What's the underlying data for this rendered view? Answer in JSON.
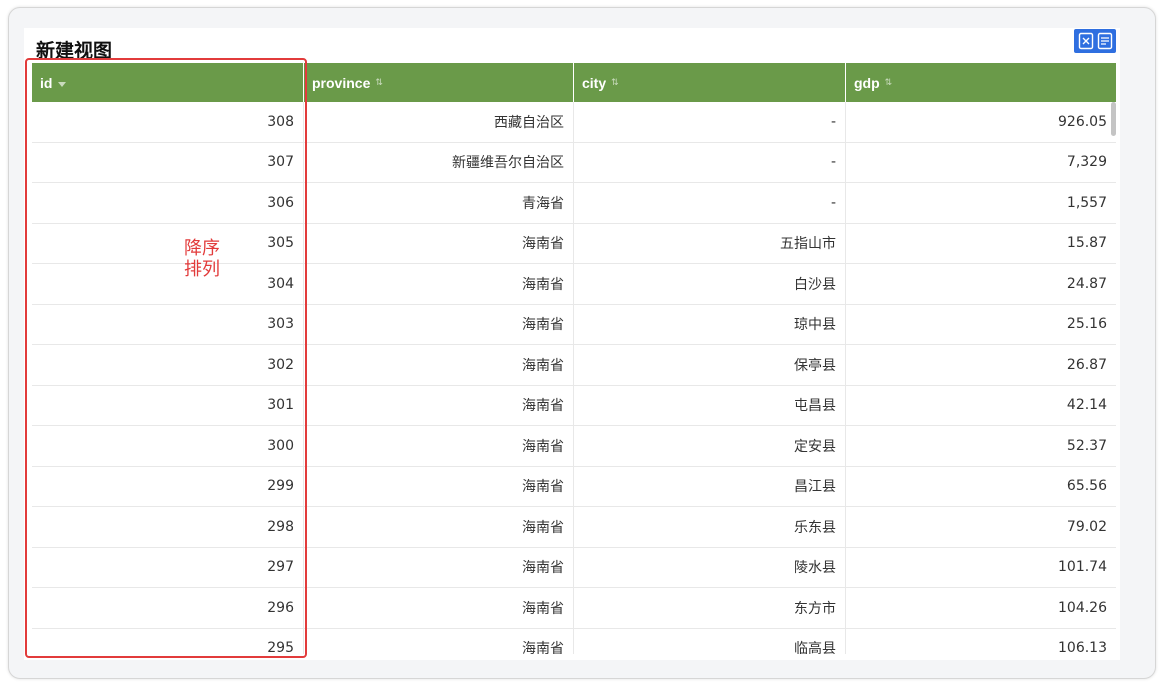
{
  "view": {
    "title": "新建视图"
  },
  "export_icons": [
    "export-excel-icon",
    "export-report-icon"
  ],
  "colors": {
    "header_bg": "#6a9a49",
    "accent_blue": "#2f6fe0",
    "annotation_red": "#e23b3b"
  },
  "table": {
    "columns": [
      {
        "key": "id",
        "label": "id",
        "sort": "desc"
      },
      {
        "key": "province",
        "label": "province",
        "sort": "none",
        "sort_glyph": "⇅"
      },
      {
        "key": "city",
        "label": "city",
        "sort": "none",
        "sort_glyph": "⇅"
      },
      {
        "key": "gdp",
        "label": "gdp",
        "sort": "none",
        "sort_glyph": "⇅"
      }
    ],
    "rows": [
      {
        "id": "308",
        "province": "西藏自治区",
        "city": "-",
        "gdp": "926.05"
      },
      {
        "id": "307",
        "province": "新疆维吾尔自治区",
        "city": "-",
        "gdp": "7,329"
      },
      {
        "id": "306",
        "province": "青海省",
        "city": "-",
        "gdp": "1,557"
      },
      {
        "id": "305",
        "province": "海南省",
        "city": "五指山市",
        "gdp": "15.87"
      },
      {
        "id": "304",
        "province": "海南省",
        "city": "白沙县",
        "gdp": "24.87"
      },
      {
        "id": "303",
        "province": "海南省",
        "city": "琼中县",
        "gdp": "25.16"
      },
      {
        "id": "302",
        "province": "海南省",
        "city": "保亭县",
        "gdp": "26.87"
      },
      {
        "id": "301",
        "province": "海南省",
        "city": "屯昌县",
        "gdp": "42.14"
      },
      {
        "id": "300",
        "province": "海南省",
        "city": "定安县",
        "gdp": "52.37"
      },
      {
        "id": "299",
        "province": "海南省",
        "city": "昌江县",
        "gdp": "65.56"
      },
      {
        "id": "298",
        "province": "海南省",
        "city": "乐东县",
        "gdp": "79.02"
      },
      {
        "id": "297",
        "province": "海南省",
        "city": "陵水县",
        "gdp": "101.74"
      },
      {
        "id": "296",
        "province": "海南省",
        "city": "东方市",
        "gdp": "104.26"
      },
      {
        "id": "295",
        "province": "海南省",
        "city": "临高县",
        "gdp": "106.13"
      }
    ]
  },
  "annotation": {
    "line1": "降序",
    "line2": "排列"
  }
}
